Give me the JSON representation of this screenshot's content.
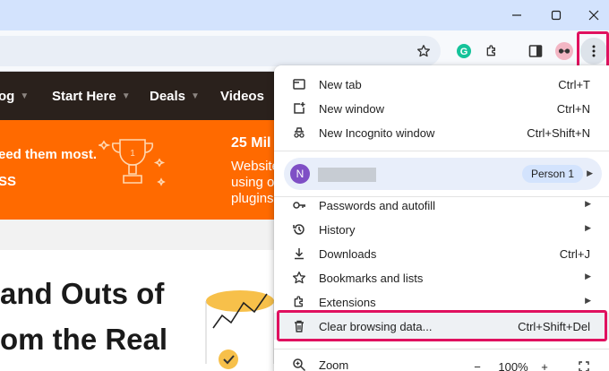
{
  "titlebar": {
    "minimize_icon": "minimize-icon",
    "maximize_icon": "maximize-icon",
    "close_icon": "close-icon"
  },
  "toolbar": {
    "icons": [
      "star-icon",
      "grammarly-icon",
      "extensions-puzzle-icon",
      "side-panel-icon",
      "profile-avatar-icon",
      "more-vertical-icon"
    ],
    "highlight_color": "#e0115f"
  },
  "page": {
    "nav": [
      {
        "label": "og"
      },
      {
        "label": "Start Here"
      },
      {
        "label": "Deals"
      },
      {
        "label": "Videos"
      }
    ],
    "banner": {
      "line1": "eed them most.",
      "line2": "SS",
      "right_title": "25 Mil",
      "right_lines": [
        "Website",
        "using o",
        "plugins"
      ]
    },
    "headline_lines": [
      "and Outs of",
      "om the Real"
    ],
    "accent": "#ff6a00"
  },
  "menu": {
    "items_top": [
      {
        "label": "New tab",
        "shortcut": "Ctrl+T",
        "icon": "new-tab-icon"
      },
      {
        "label": "New window",
        "shortcut": "Ctrl+N",
        "icon": "new-window-icon"
      },
      {
        "label": "New Incognito window",
        "shortcut": "Ctrl+Shift+N",
        "icon": "incognito-icon"
      }
    ],
    "profile": {
      "avatar_letter": "N",
      "chip": "Person 1"
    },
    "items_mid": [
      {
        "label": "Passwords and autofill",
        "icon": "key-icon"
      },
      {
        "label": "History",
        "icon": "history-icon"
      },
      {
        "label": "Downloads",
        "shortcut": "Ctrl+J",
        "icon": "download-icon"
      },
      {
        "label": "Bookmarks and lists",
        "icon": "bookmark-star-icon"
      },
      {
        "label": "Extensions",
        "icon": "extension-icon"
      },
      {
        "label": "Clear browsing data...",
        "shortcut": "Ctrl+Shift+Del",
        "icon": "trash-icon"
      }
    ],
    "zoom": {
      "label": "Zoom",
      "minus": "−",
      "value": "100%",
      "plus": "+"
    }
  }
}
